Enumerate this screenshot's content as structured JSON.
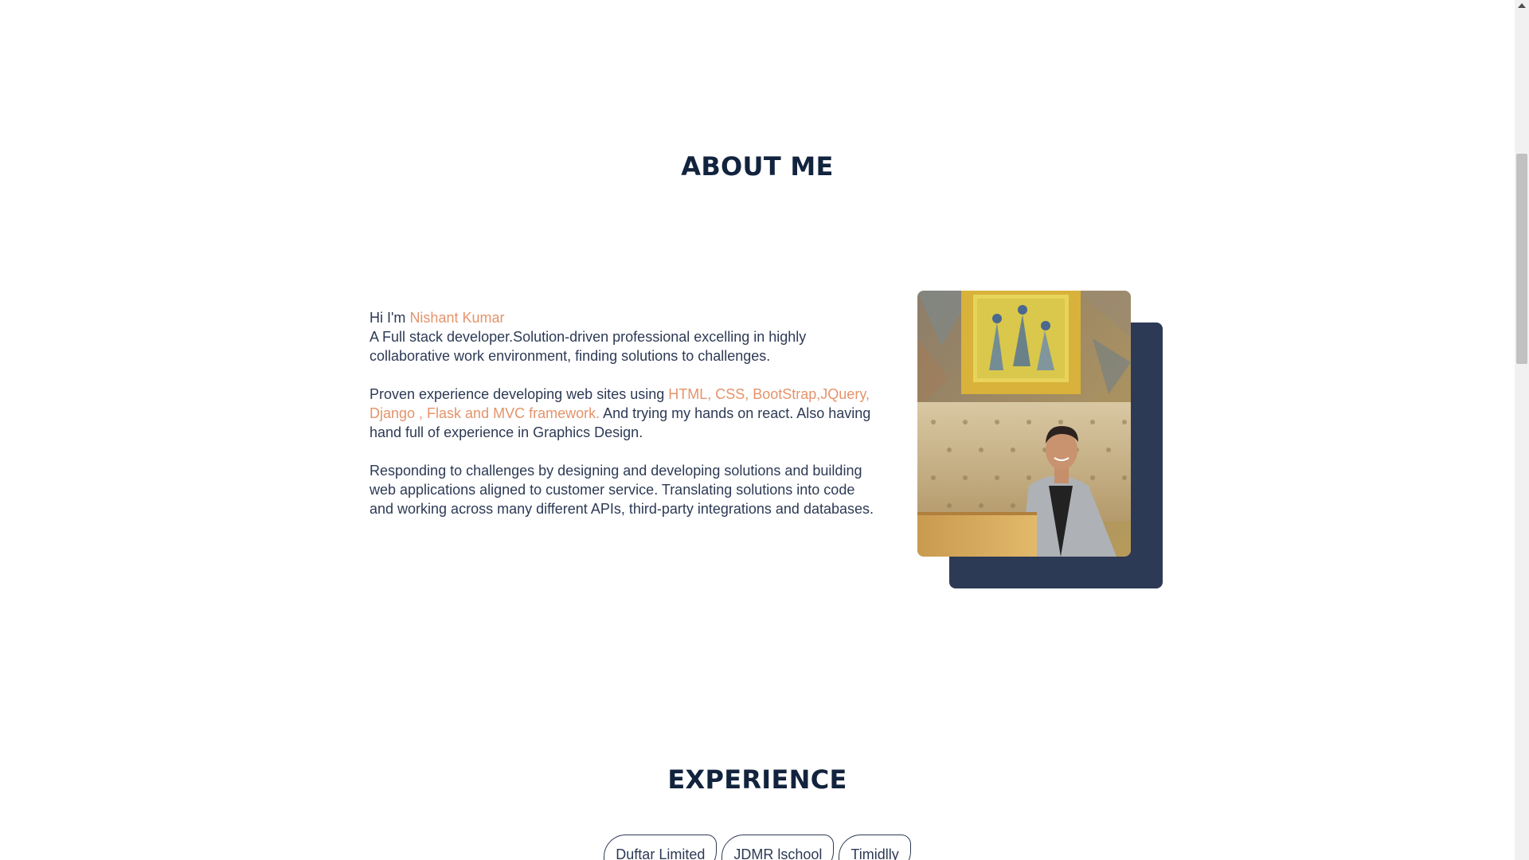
{
  "about": {
    "title": "ABOUT ME",
    "greeting_prefix": "Hi I'm ",
    "name": "Nishant Kumar",
    "intro": "A Full stack developer.Solution-driven professional excelling in highly collaborative work environment, finding solutions to challenges.",
    "p2_prefix": "Proven experience developing web sites using ",
    "p2_skills": "HTML, CSS, BootStrap,JQuery, Django , Flask and MVC framework.",
    "p2_suffix": " And trying my hands on react. Also having hand full of experience in Graphics Design.",
    "p3": "Responding to challenges by designing and developing solutions and building web applications aligned to customer service. Translating solutions into code and working across many different APIs, third-party integrations and databases."
  },
  "experience": {
    "title": "EXPERIENCE",
    "tabs": [
      "Duftar Limited",
      "JDMR lschool",
      "Timidlly"
    ]
  },
  "colors": {
    "heading": "#12233d",
    "text": "#2d3a55",
    "accent": "#e5936a",
    "photo_shadow": "#2d3a55"
  },
  "icons": {
    "scroll_up": "triangle-up-icon"
  }
}
